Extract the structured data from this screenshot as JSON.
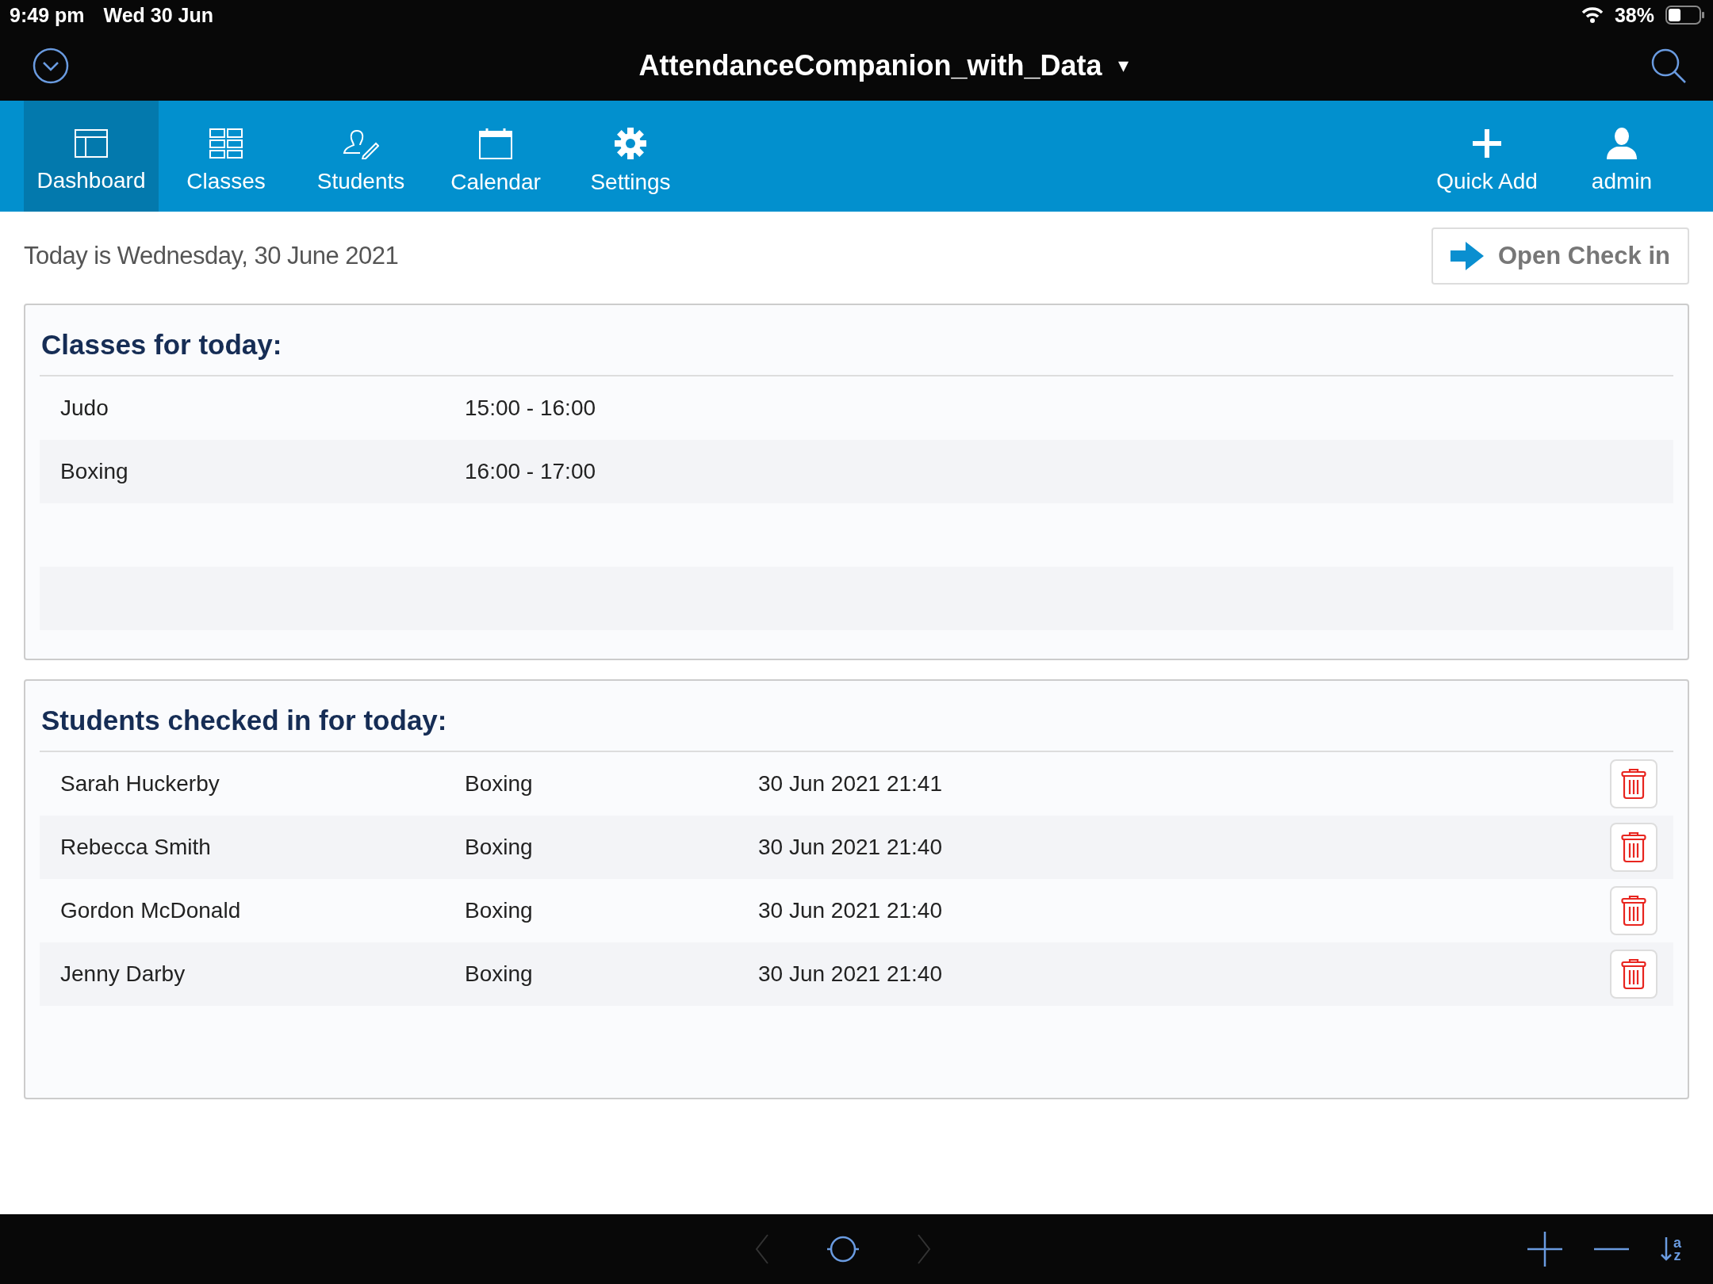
{
  "status_bar": {
    "time": "9:49 pm",
    "date": "Wed 30 Jun",
    "battery": "38%"
  },
  "header": {
    "title": "AttendanceCompanion_with_Data",
    "caret": "▾"
  },
  "nav": {
    "items": [
      {
        "label": "Dashboard",
        "selected": true
      },
      {
        "label": "Classes",
        "selected": false
      },
      {
        "label": "Students",
        "selected": false
      },
      {
        "label": "Calendar",
        "selected": false
      },
      {
        "label": "Settings",
        "selected": false
      }
    ],
    "actions": [
      {
        "label": "Quick Add",
        "kind": "add"
      },
      {
        "label": "admin",
        "kind": "user"
      }
    ]
  },
  "today_text": "Today is Wednesday, 30 June 2021",
  "open_check_in_button": "Open Check in",
  "classes_card": {
    "title": "Classes for today:",
    "rows": [
      {
        "name": "Judo",
        "time": "15:00 - 16:00"
      },
      {
        "name": "Boxing",
        "time": "16:00 - 17:00"
      }
    ]
  },
  "students_card": {
    "title": "Students checked in for today:",
    "rows": [
      {
        "name": "Sarah Huckerby",
        "class": "Boxing",
        "checked_in": "30 Jun 2021 21:41"
      },
      {
        "name": "Rebecca Smith",
        "class": "Boxing",
        "checked_in": "30 Jun 2021 21:40"
      },
      {
        "name": "Gordon McDonald",
        "class": "Boxing",
        "checked_in": "30 Jun 2021 21:40"
      },
      {
        "name": "Jenny Darby",
        "class": "Boxing",
        "checked_in": "30 Jun 2021 21:40"
      }
    ]
  },
  "bottom_bar": {
    "sort_letters": [
      "a",
      "z"
    ]
  }
}
